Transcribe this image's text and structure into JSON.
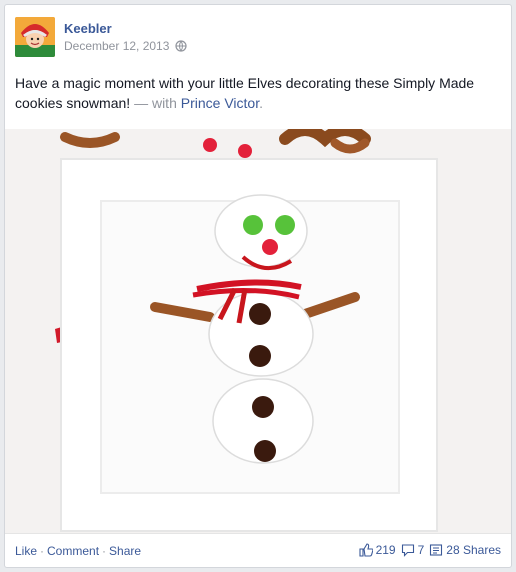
{
  "post": {
    "page_name": "Keebler",
    "date": "December 12, 2013",
    "text": "Have a magic moment with your little Elves decorating these Simply Made cookies snowman!",
    "with_label": "— with",
    "tagged_name": "Prince Victor",
    "tag_suffix": "."
  },
  "actions": {
    "like": "Like",
    "comment": "Comment",
    "share": "Share",
    "separator": "·"
  },
  "stats": {
    "likes": "219",
    "comments": "7",
    "shares": "28 Shares"
  },
  "icons": {
    "audience": "globe-icon",
    "likes": "thumbs-up-icon",
    "comments": "comment-icon",
    "shares": "share-icon"
  },
  "colors": {
    "link": "#3b5998",
    "meta": "#90949c",
    "text": "#141823"
  }
}
